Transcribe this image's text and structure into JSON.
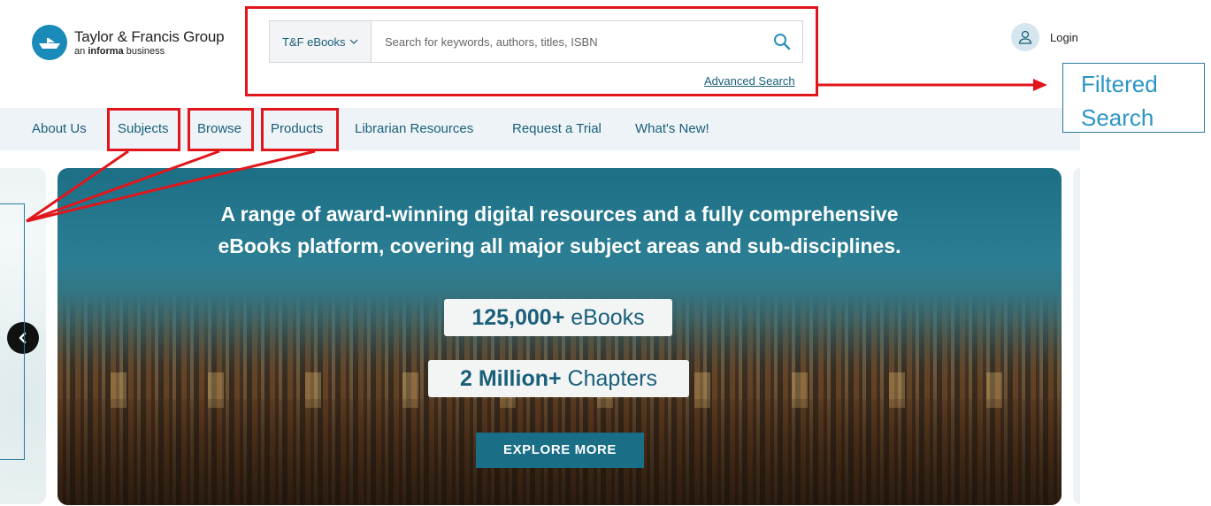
{
  "header": {
    "logo": {
      "name": "Taylor & Francis Group",
      "sub_prefix": "an",
      "sub_bold": "informa",
      "sub_suffix": "business"
    },
    "search": {
      "scope": "T&F eBooks",
      "placeholder": "Search for keywords, authors, titles, ISBN",
      "advanced_label": "Advanced Search"
    },
    "login_label": "Login"
  },
  "nav": {
    "items": [
      {
        "label": "About Us"
      },
      {
        "label": "Subjects"
      },
      {
        "label": "Browse"
      },
      {
        "label": "Products"
      },
      {
        "label": "Librarian Resources"
      },
      {
        "label": "Request a Trial"
      },
      {
        "label": "What's New!"
      }
    ]
  },
  "hero": {
    "title_line1": "A range of award-winning digital resources and a fully comprehensive",
    "title_line2": "eBooks platform, covering all major subject areas and sub-disciplines.",
    "stat1_value": "125,000+",
    "stat1_label": "eBooks",
    "stat2_value": "2 Million+",
    "stat2_label": "Chapters",
    "cta": "EXPLORE MORE"
  },
  "annotations": {
    "filtered_search_line1": "Filtered",
    "filtered_search_line2": "Search",
    "color": "#e0161c"
  }
}
